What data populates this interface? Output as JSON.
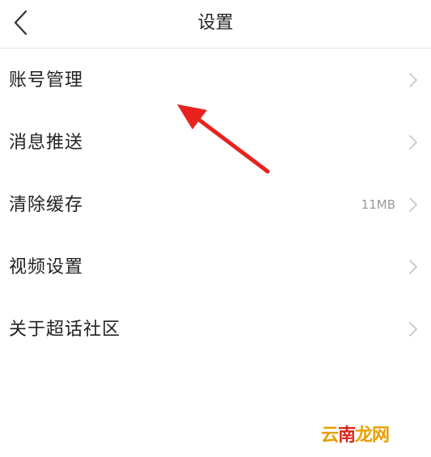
{
  "header": {
    "title": "设置",
    "back_icon": "chevron-left-icon"
  },
  "menu": {
    "items": [
      {
        "label": "账号管理",
        "value": ""
      },
      {
        "label": "消息推送",
        "value": ""
      },
      {
        "label": "清除缓存",
        "value": "11MB"
      },
      {
        "label": "视频设置",
        "value": ""
      },
      {
        "label": "关于超话社区",
        "value": ""
      }
    ]
  },
  "annotation": {
    "arrow_color": "#e8231e"
  },
  "watermark": {
    "text_a": "云",
    "text_b": "南",
    "text_c": "龙网",
    "color": "#e8a000"
  },
  "colors": {
    "text": "#222222",
    "secondary": "#999999",
    "divider": "#e6e6e6",
    "chevron": "#c4c4c4"
  }
}
